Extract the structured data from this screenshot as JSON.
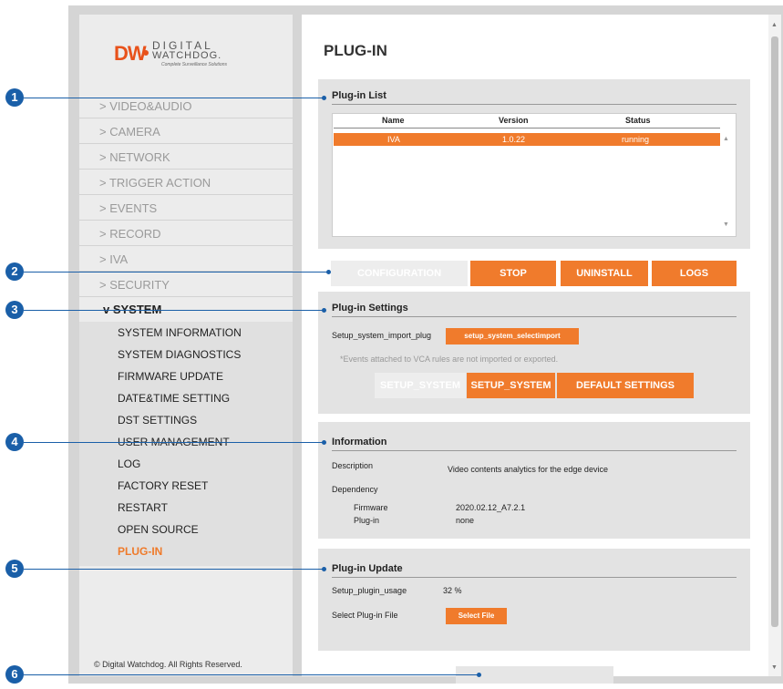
{
  "logo": {
    "mark": "DW",
    "line1": "DIGITAL",
    "line2": "WATCHDOG.",
    "tagline": "Complete Surveillance Solutions"
  },
  "sidebar": {
    "menu": [
      "> VIDEO&AUDIO",
      "> CAMERA",
      "> NETWORK",
      "> TRIGGER ACTION",
      "> EVENTS",
      "> RECORD",
      "> IVA",
      "> SECURITY"
    ],
    "system_label": "v SYSTEM",
    "submenu": [
      "SYSTEM INFORMATION",
      "SYSTEM DIAGNOSTICS",
      "FIRMWARE UPDATE",
      "DATE&TIME SETTING",
      "DST SETTINGS",
      "USER MANAGEMENT",
      "LOG",
      "FACTORY RESET",
      "RESTART",
      "OPEN SOURCE",
      "PLUG-IN"
    ],
    "copyright": "© Digital Watchdog. All Rights Reserved."
  },
  "page_title": "PLUG-IN",
  "plugin_list": {
    "title": "Plug-in List",
    "columns": [
      "Name",
      "Version",
      "Status"
    ],
    "rows": [
      {
        "name": "IVA",
        "version": "1.0.22",
        "status": "running"
      }
    ]
  },
  "actions": {
    "configuration": "CONFIGURATION",
    "stop": "STOP",
    "uninstall": "UNINSTALL",
    "logs": "LOGS"
  },
  "plugin_settings": {
    "title": "Plug-in Settings",
    "import_label": "Setup_system_import_plug",
    "import_button": "setup_system_selectimport",
    "note": "*Events attached to VCA rules are not imported or exported.",
    "btn_setup1": "SETUP_SYSTEM",
    "btn_setup2": "SETUP_SYSTEM",
    "btn_default": "DEFAULT SETTINGS"
  },
  "information": {
    "title": "Information",
    "description_label": "Description",
    "description_value": "Video contents analytics for the edge device",
    "dependency_label": "Dependency",
    "firmware_label": "Firmware",
    "firmware_value": "2020.02.12_A7.2.1",
    "plugin_label": "Plug-in",
    "plugin_value": "none"
  },
  "plugin_update": {
    "title": "Plug-in Update",
    "usage_label": "Setup_plugin_usage",
    "usage_value": "32 %",
    "select_label": "Select Plug-in File",
    "select_button": "Select File"
  },
  "callouts": [
    "1",
    "2",
    "3",
    "4",
    "5",
    "6"
  ],
  "colors": {
    "accent": "#f07b2c",
    "callout": "#1a5fa8"
  }
}
